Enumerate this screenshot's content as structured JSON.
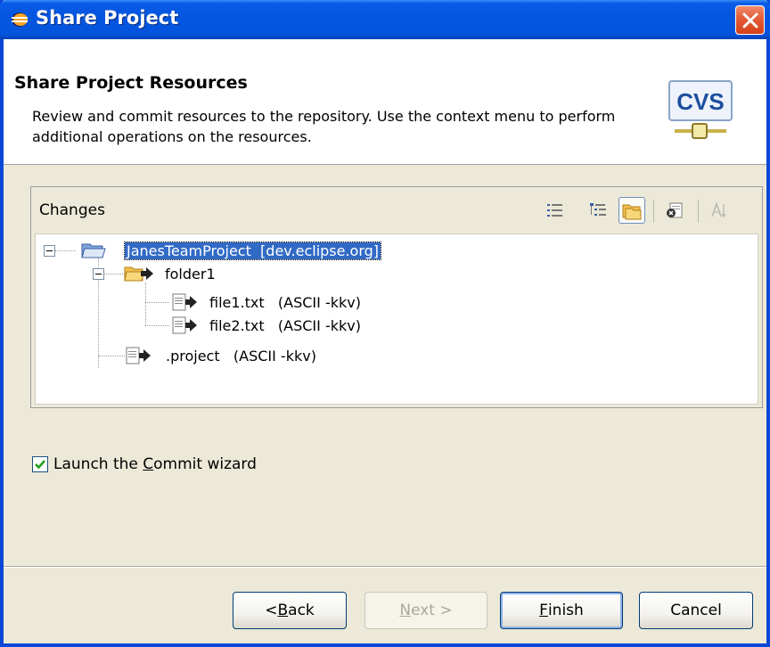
{
  "window": {
    "title": "Share Project",
    "colors": {
      "titlebar": "#0454dd",
      "selection": "#316ac5",
      "close": "#d5421b"
    }
  },
  "banner": {
    "title": "Share Project Resources",
    "description": "Review and commit resources to the repository. Use the context menu to perform additional operations on the resources.",
    "logo_text": "CVS"
  },
  "changes": {
    "label": "Changes",
    "toolbar_icons": [
      "flat-mode-icon",
      "tree-mode-icon",
      "compressed-folders-icon",
      "commit-icon",
      "sort-icon"
    ],
    "tree": [
      {
        "label": "JanesTeamProject  [dev.eclipse.org]",
        "level": 0,
        "type": "project",
        "selected": true
      },
      {
        "label": "folder1",
        "level": 1,
        "type": "folder"
      },
      {
        "label": "file1.txt   (ASCII -kkv)",
        "level": 2,
        "type": "file"
      },
      {
        "label": "file2.txt   (ASCII -kkv)",
        "level": 2,
        "type": "file"
      },
      {
        "label": ".project   (ASCII -kkv)",
        "level": 1,
        "type": "file"
      }
    ]
  },
  "launch_commit": {
    "label_pre": "Launch the ",
    "label_mnemonic": "C",
    "label_post": "ommit wizard",
    "checked": true
  },
  "buttons": {
    "back": {
      "pre": "< ",
      "mnemonic": "B",
      "post": "ack"
    },
    "next": {
      "pre": "",
      "mnemonic": "N",
      "post": "ext >"
    },
    "finish": {
      "pre": "",
      "mnemonic": "F",
      "post": "inish"
    },
    "cancel": "Cancel"
  }
}
